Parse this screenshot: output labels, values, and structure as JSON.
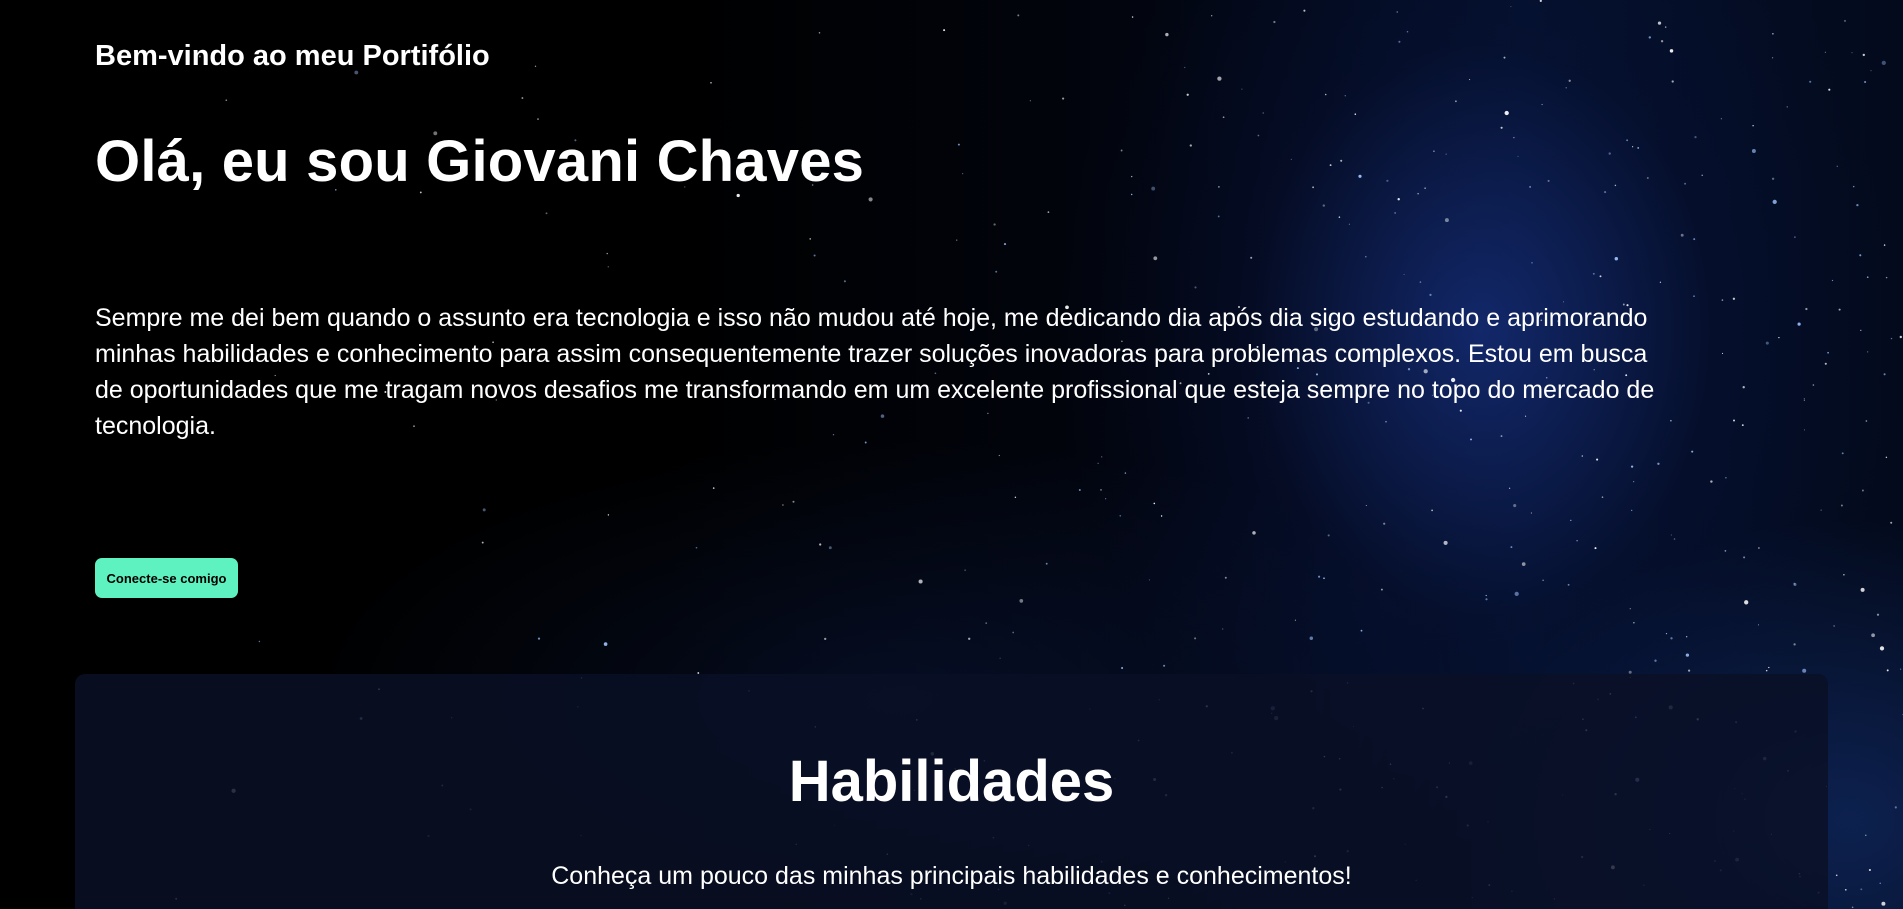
{
  "hero": {
    "tagline": "Bem-vindo ao meu Portifólio",
    "title": "Olá, eu sou Giovani Chaves",
    "intro": "Sempre me dei bem quando o assunto era tecnologia e isso não mudou até hoje, me dedicando dia após dia sigo estudando e aprimorando minhas habilidades e conhecimento para assim consequentemente trazer soluções inovadoras para problemas complexos. Estou em busca de oportunidades que me tragam novos desafios me transformando em um excelente profissional que esteja sempre no topo do mercado de tecnologia.",
    "cta_label": "Conecte-se comigo"
  },
  "skills": {
    "title": "Habilidades",
    "subtitle": "Conheça um pouco das minhas principais habilidades e conhecimentos!"
  },
  "colors": {
    "accent": "#5ef2c0",
    "background": "#000000",
    "panel": "#0a1026",
    "text": "#ffffff"
  }
}
